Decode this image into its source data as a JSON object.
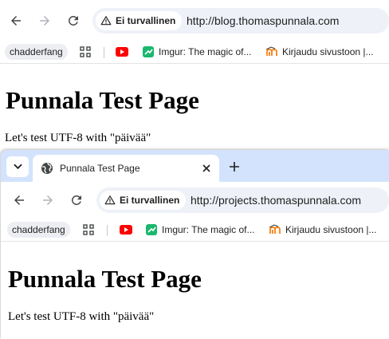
{
  "window1": {
    "security_label": "Ei turvallinen",
    "url": "http://blog.thomaspunnala.com",
    "bookmarks": [
      {
        "label": "chadderfang"
      },
      {
        "label": ""
      },
      {
        "label": ""
      },
      {
        "label": "Imgur: The magic of..."
      },
      {
        "label": "Kirjaudu sivustoon |..."
      }
    ],
    "page": {
      "heading": "Punnala Test Page",
      "paragraph": "Let's test UTF-8 with \"päivää\""
    }
  },
  "window2": {
    "tab_title": "Punnala Test Page",
    "security_label": "Ei turvallinen",
    "url": "http://projects.thomaspunnala.com",
    "bookmarks": [
      {
        "label": "chadderfang"
      },
      {
        "label": ""
      },
      {
        "label": ""
      },
      {
        "label": "Imgur: The magic of..."
      },
      {
        "label": "Kirjaudu sivustoon |..."
      }
    ],
    "page": {
      "heading": "Punnala Test Page",
      "paragraph": "Let's test UTF-8 with \"päivää\""
    }
  },
  "icons": [
    "back-arrow-icon",
    "forward-arrow-icon",
    "reload-icon",
    "warning-icon",
    "apps-grid-icon",
    "youtube-icon",
    "imgur-icon",
    "moodle-icon",
    "globe-icon",
    "close-icon",
    "plus-icon",
    "chevron-down-icon"
  ]
}
